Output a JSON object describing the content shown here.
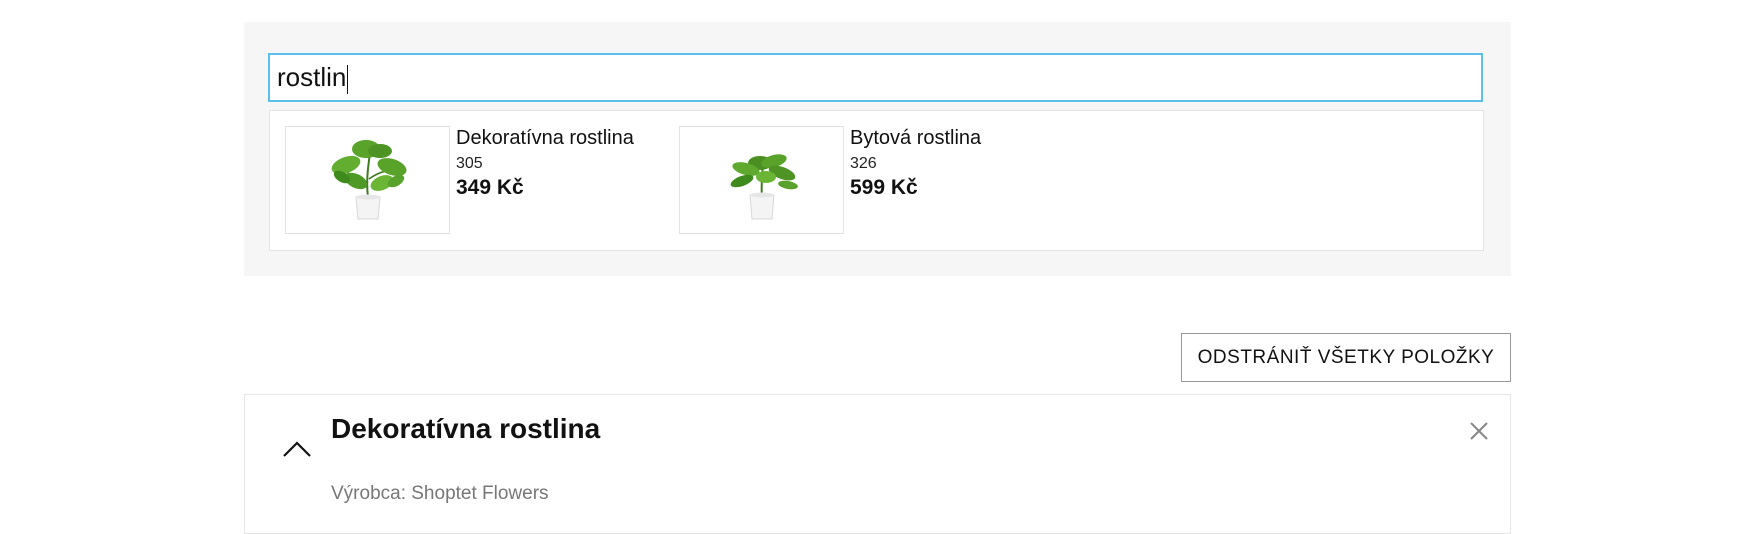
{
  "search": {
    "value": "rostlin"
  },
  "results": [
    {
      "name": "Dekoratívna rostlina",
      "code": "305",
      "price": "349 Kč",
      "image": "plant-image"
    },
    {
      "name": "Bytová rostlina",
      "code": "326",
      "price": "599 Kč",
      "image": "plant-image"
    }
  ],
  "cart": {
    "remove_all_label": "ODSTRÁNIŤ VŠETKY POLOŽKY",
    "items": [
      {
        "title": "Dekoratívna rostlina",
        "manufacturer": "Výrobca: Shoptet Flowers",
        "toggle_icon": "chevron-up-icon",
        "remove_icon": "close-icon"
      }
    ]
  },
  "colors": {
    "input_border": "#5bc0eb",
    "panel_bg": "#f6f6f6",
    "muted_text": "#777777"
  }
}
